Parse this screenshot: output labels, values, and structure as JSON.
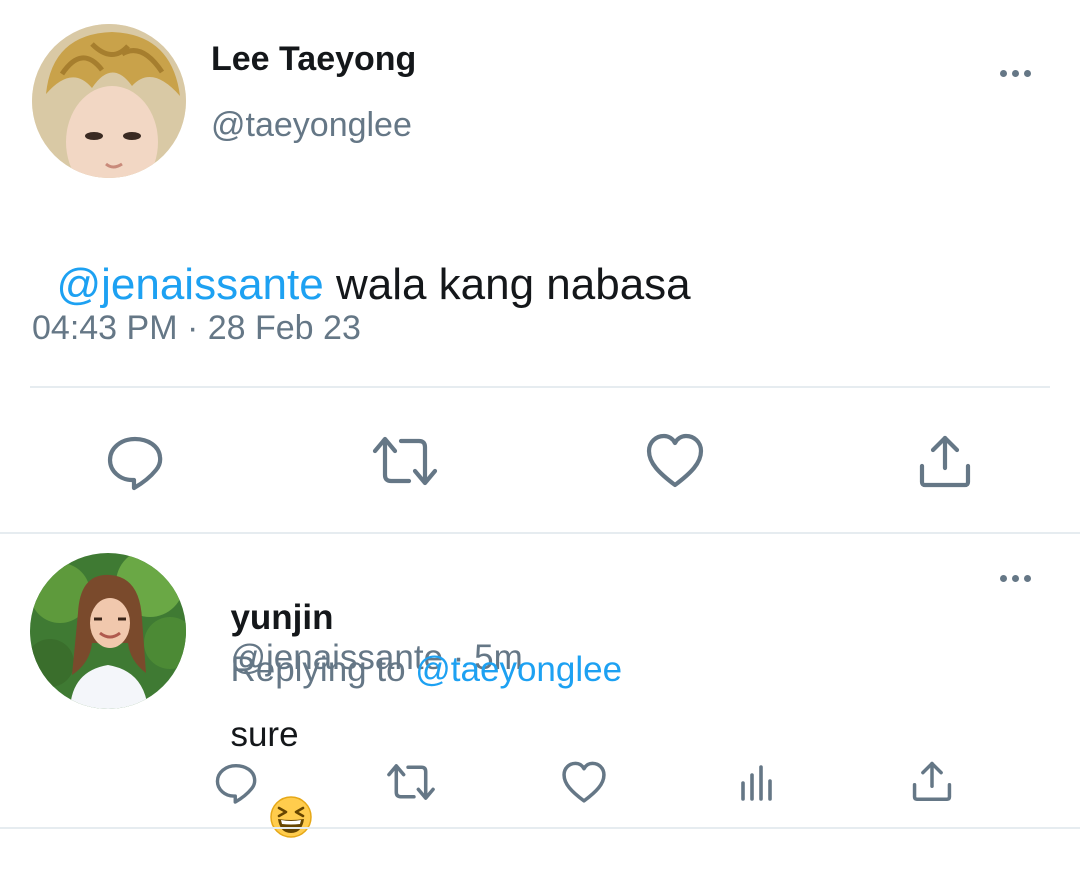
{
  "main_tweet": {
    "author_name": "Lee Taeyong",
    "author_handle": "@taeyonglee",
    "mention": "@jenaissante",
    "text": " wala kang nabasa",
    "timestamp": "04:43 PM · 28 Feb 23"
  },
  "reply_tweet": {
    "author_name": "yunjin",
    "author_handle": "@jenaissante",
    "time_sep": " · ",
    "age": "5m",
    "replying_label": "Replying to ",
    "replying_handle": "@taeyonglee",
    "text": "sure",
    "emoji": "😆"
  },
  "icons": [
    "more-dots-icon",
    "reply-icon",
    "retweet-icon",
    "like-icon",
    "share-icon",
    "analytics-icon"
  ],
  "colors": {
    "link": "#1da1f2",
    "secondary": "#657786",
    "divider": "#e6ecf0",
    "text": "#14171a"
  }
}
